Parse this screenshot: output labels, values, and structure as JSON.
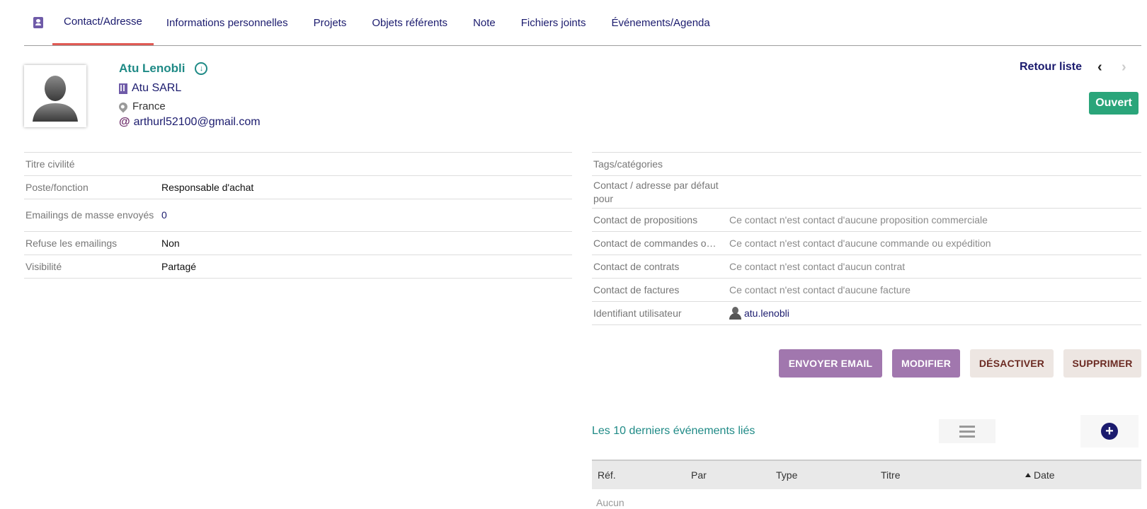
{
  "tabs": [
    {
      "label": "Contact/Adresse",
      "active": true
    },
    {
      "label": "Informations personnelles"
    },
    {
      "label": "Projets"
    },
    {
      "label": "Objets référents"
    },
    {
      "label": "Note"
    },
    {
      "label": "Fichiers joints"
    },
    {
      "label": "Événements/Agenda"
    }
  ],
  "contact": {
    "name": "Atu Lenobli",
    "company": "Atu SARL",
    "country": "France",
    "email": "arthurl52100@gmail.com"
  },
  "nav": {
    "back_label": "Retour liste",
    "prev_icon": "‹",
    "next_icon": "›",
    "status": "Ouvert",
    "status_color": "#2aa57a"
  },
  "left_fields": [
    {
      "label": "Titre civilité",
      "value": ""
    },
    {
      "label": "Poste/fonction",
      "value": "Responsable d'achat"
    },
    {
      "label": "Emailings de masse envoyés",
      "value": "0"
    },
    {
      "label": "Refuse les emailings",
      "value": "Non"
    },
    {
      "label": "Visibilité",
      "value": "Partagé"
    }
  ],
  "right_fields": [
    {
      "label": "Tags/catégories",
      "value": ""
    },
    {
      "label": "Contact / adresse par défaut pour",
      "value": ""
    },
    {
      "label": "Contact de propositions",
      "value": "Ce contact n'est contact d'aucune proposition commerciale"
    },
    {
      "label": "Contact de commandes o…",
      "value": "Ce contact n'est contact d'aucune commande ou expédition"
    },
    {
      "label": "Contact de contrats",
      "value": "Ce contact n'est contact d'aucun contrat"
    },
    {
      "label": "Contact de factures",
      "value": "Ce contact n'est contact d'aucune facture"
    },
    {
      "label": "Identifiant utilisateur",
      "value": "atu.lenobli"
    }
  ],
  "actions": {
    "send_email": "ENVOYER EMAIL",
    "edit": "MODIFIER",
    "deactivate": "DÉSACTIVER",
    "delete": "SUPPRIMER"
  },
  "events": {
    "title": "Les 10 derniers événements liés",
    "columns": [
      "Réf.",
      "Par",
      "Type",
      "Titre",
      "Date"
    ],
    "empty": "Aucun"
  },
  "icons": {
    "contact_tab": "contact-card-icon",
    "download": "download-circle-icon",
    "company": "building-icon",
    "location": "map-pin-icon",
    "email": "at-icon",
    "user": "user-icon",
    "list": "list-icon",
    "add": "plus-circle-icon"
  },
  "colors": {
    "accent_purple": "#a177ae",
    "link_navy": "#1b1b6e",
    "teal": "#1f8a86",
    "tab_underline": "#e05a54"
  }
}
